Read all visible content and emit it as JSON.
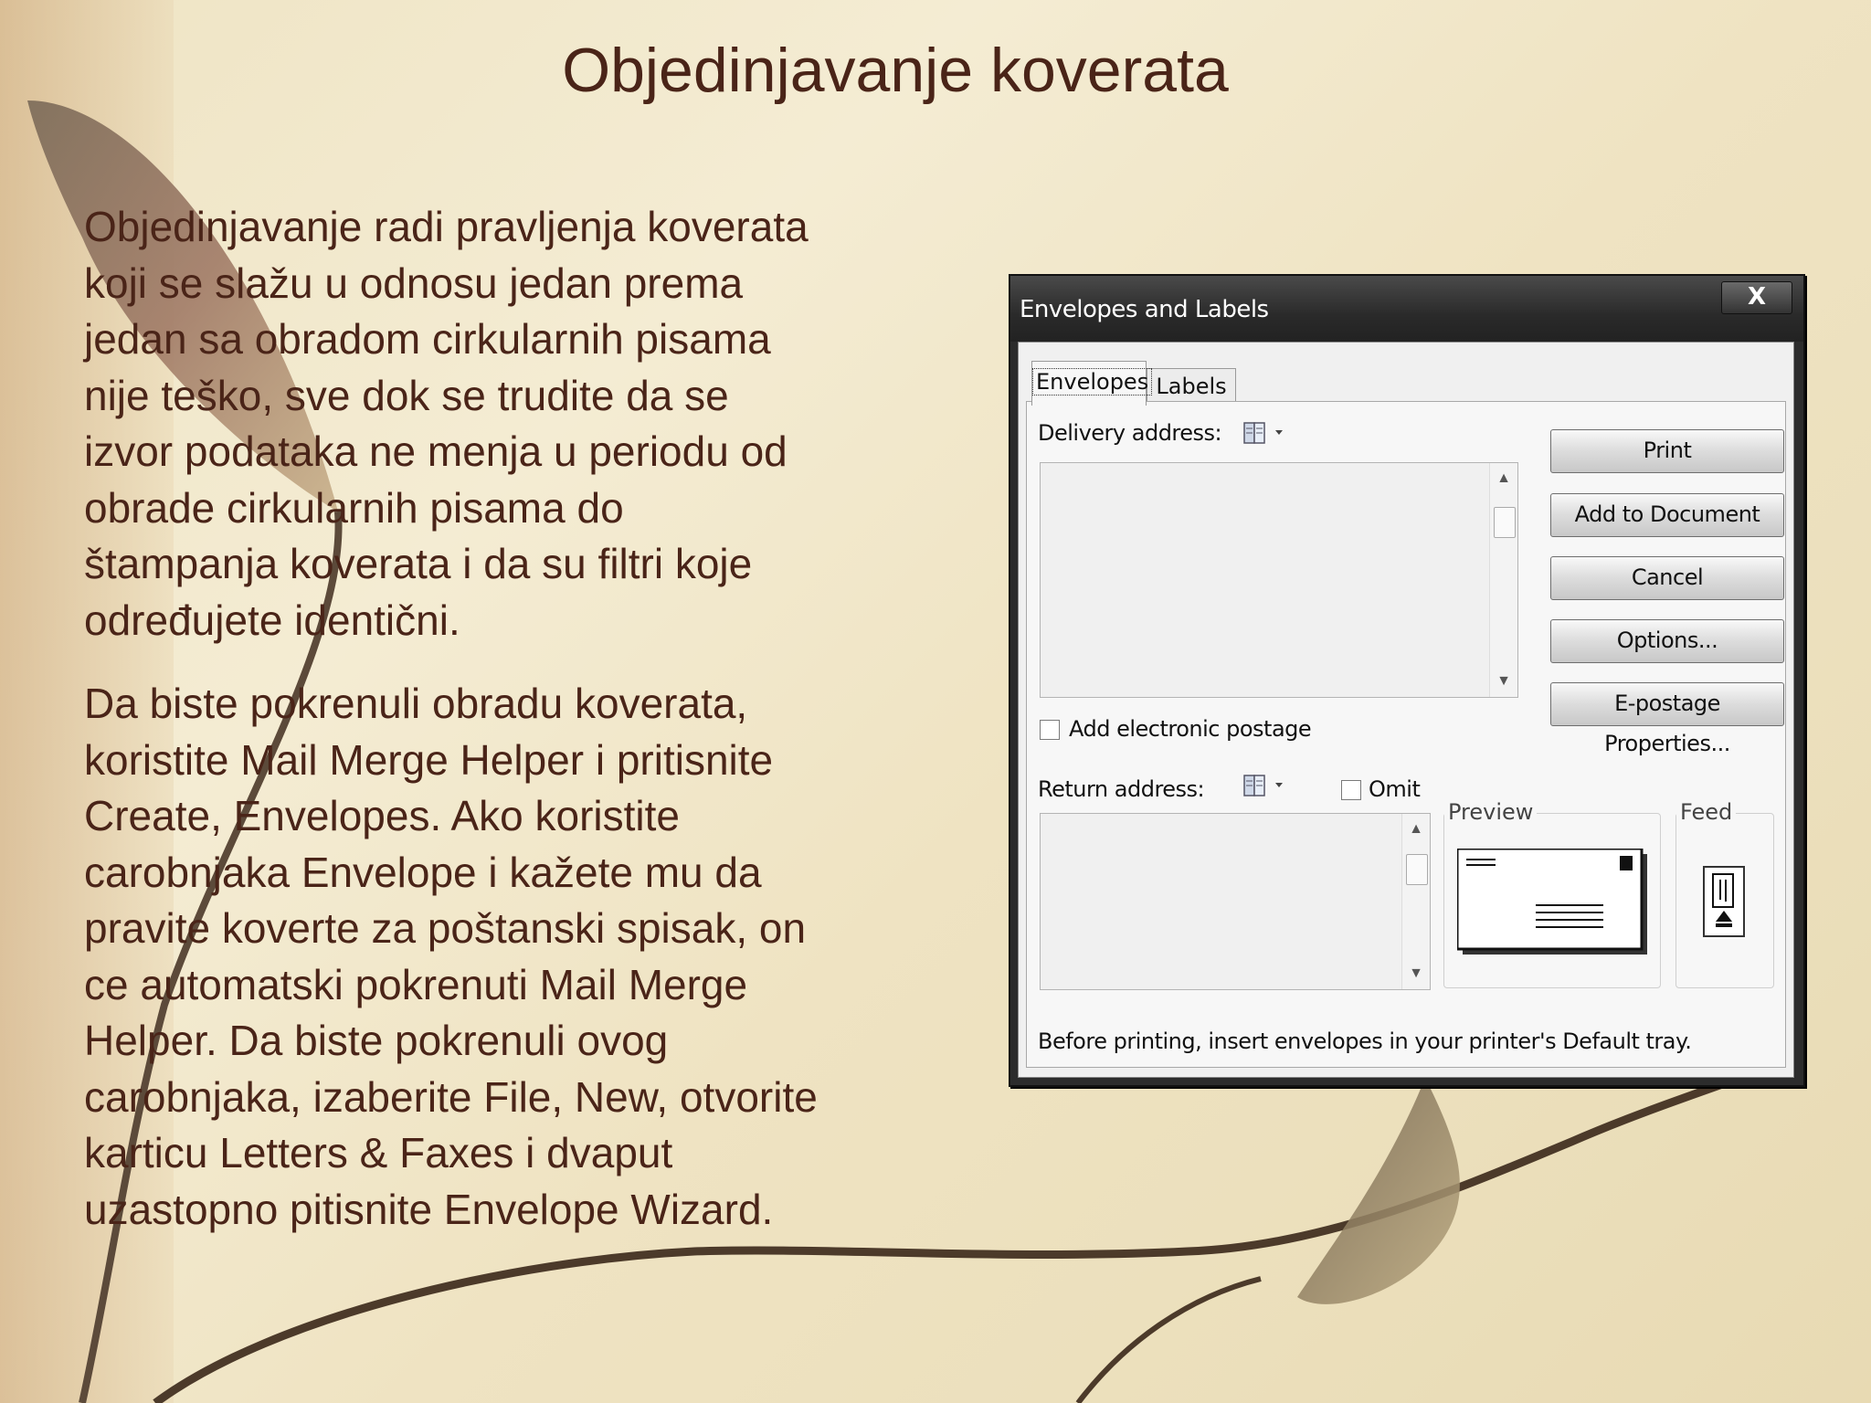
{
  "slide": {
    "title": "Objedinjavanje koverata",
    "paragraphs": [
      "Objedinjavanje radi pravljenja koverata\nkoji se slažu u odnosu jedan prema\njedan sa obradom cirkularnih pisama\nnije teško, sve dok se trudite da se\nizvor podataka ne menja u periodu od\nobrade cirkularnih pisama do\nštampanja koverata i da su filtri koje\nodređujete identični.",
      "Da biste pokrenuli obradu koverata,\nkoristite Mail Merge Helper i pritisnite\nCreate, Envelopes. Ako koristite\ncarobnjaka Envelope i kažete mu da\npravite koverte za poštanski spisak, on\nce automatski pokrenuti Mail Merge\nHelper. Da biste pokrenuli ovog\ncarobnjaka, izaberite File, New, otvorite\nkarticu Letters & Faxes i dvaput\nuzastopno pitisnite Envelope Wizard."
    ]
  },
  "dialog": {
    "title": "Envelopes and Labels",
    "close_label": "X",
    "tabs": [
      {
        "label": "Envelopes",
        "active": true
      },
      {
        "label": "Labels",
        "active": false
      }
    ],
    "delivery_address_label": "Delivery address:",
    "delivery_address_value": "",
    "add_postage_label": "Add electronic postage",
    "return_address_label": "Return address:",
    "return_address_value": "",
    "omit_label": "Omit",
    "preview_label": "Preview",
    "feed_label": "Feed",
    "footer_note": "Before printing, insert envelopes in your printer's Default tray.",
    "buttons": {
      "print": "Print",
      "add_to_document": "Add to Document",
      "cancel": "Cancel",
      "options": "Options...",
      "epostage": "E-postage Properties..."
    },
    "icons": {
      "address_book": "address-book-icon",
      "dropdown": "chevron-down-icon"
    }
  }
}
